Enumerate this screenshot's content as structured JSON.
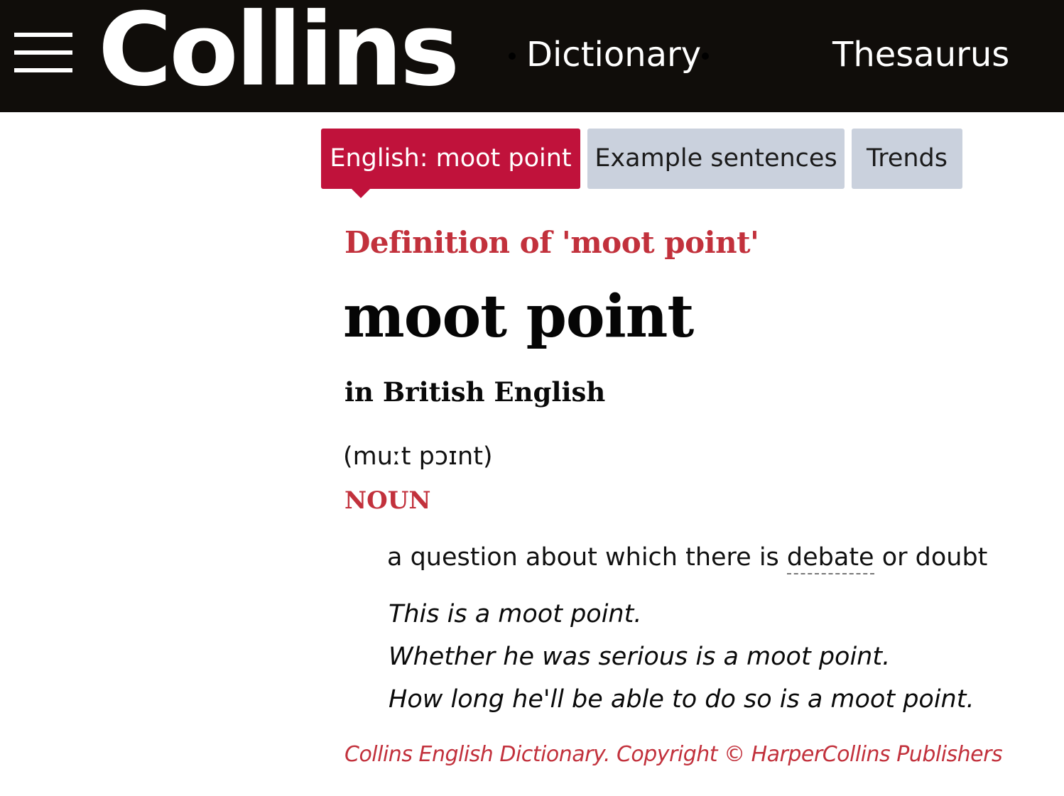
{
  "header": {
    "menu_icon": "hamburger-menu-icon",
    "logo_text": "Collins",
    "nav": {
      "dictionary_label": "Dictionary",
      "thesaurus_label": "Thesaurus"
    }
  },
  "tabs": [
    {
      "label": "English: moot point",
      "active": true
    },
    {
      "label": "Example sentences",
      "active": false
    },
    {
      "label": "Trends",
      "active": false
    }
  ],
  "entry": {
    "definition_heading": "Definition of 'moot point'",
    "headword": "moot point",
    "variety": "in British English",
    "pronunciation": "(muːt pɔɪnt)",
    "part_of_speech": "NOUN",
    "sense": {
      "text_before": "a question about which there is ",
      "link_word": "debate",
      "text_after": " or doubt"
    },
    "examples": [
      "This is a moot point.",
      "Whether he was serious is a moot point.",
      "How long he'll be able to do so is a moot point."
    ],
    "copyright": "Collins English Dictionary. Copyright © HarperCollins Publishers"
  },
  "colors": {
    "header_bg": "#100d0a",
    "brand_red": "#c0123b",
    "heading_red": "#c2313c",
    "tab_inactive_bg": "#cad1dd"
  }
}
